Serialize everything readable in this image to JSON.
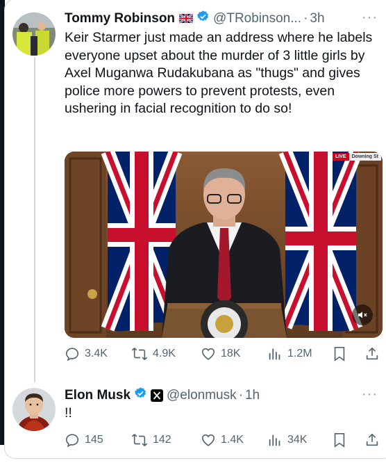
{
  "tweets": [
    {
      "name": "Tommy Robinson",
      "flag": "🇬🇧",
      "handle": "@TRobinson...",
      "separator": "·",
      "time": "3h",
      "more": "···",
      "text": "Keir Starmer just made an address where he labels everyone upset about the murder of 3 little girls by Axel Muganwa Rudakubana as \"thugs\" and gives police more powers to prevent protests, even ushering in facial recognition to do so!",
      "media": {
        "live_label": "LIVE",
        "location_label": "Downing St"
      },
      "stats": {
        "replies": "3.4K",
        "reposts": "4.9K",
        "likes": "18K",
        "views": "1.2M"
      }
    },
    {
      "name": "Elon Musk",
      "handle": "@elonmusk",
      "separator": "·",
      "time": "1h",
      "more": "···",
      "text": "!!",
      "stats": {
        "replies": "145",
        "reposts": "142",
        "likes": "1.4K",
        "views": "34K"
      }
    }
  ],
  "colors": {
    "verified": "#1d9bf0",
    "muted_text": "#536471",
    "union_red": "#c8102e",
    "union_blue": "#012169"
  }
}
